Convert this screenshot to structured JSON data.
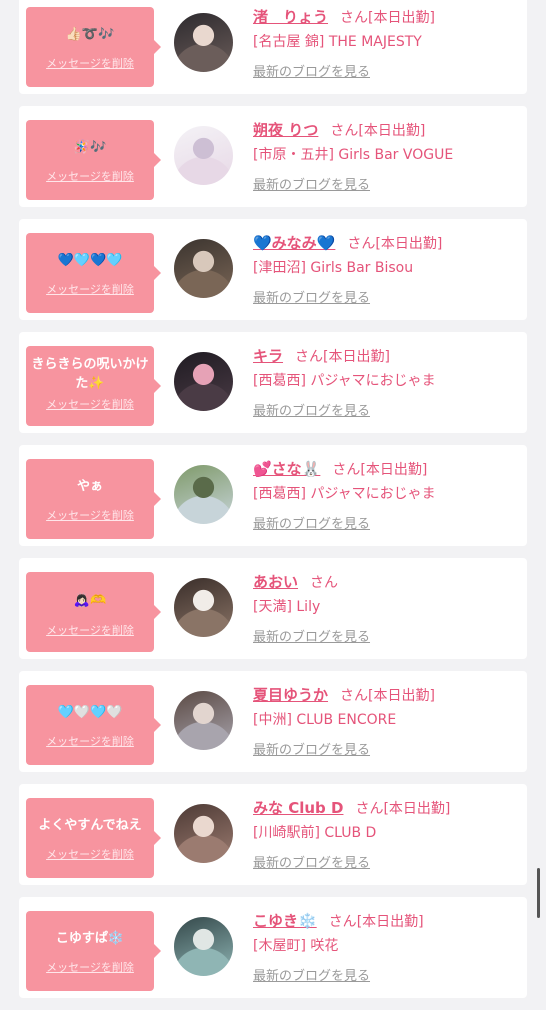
{
  "cards": [
    {
      "message": "👍🏻➰🎶",
      "delete_label": "メッセージを削除",
      "name": "渚　りょう",
      "san": "さん",
      "today": "[本日出勤]",
      "shop": "[名古屋 錦] THE MAJESTY",
      "blog": "最新のブログを見る",
      "avatar_colors": [
        "#2d2a2e",
        "#6b5d5a",
        "#e9d8cf"
      ]
    },
    {
      "message": "🪅🎶",
      "delete_label": "メッセージを削除",
      "name": "朔夜 りつ",
      "san": "さん",
      "today": "[本日出勤]",
      "shop": "[市原・五井] Girls Bar VOGUE",
      "blog": "最新のブログを見る",
      "avatar_colors": [
        "#f4f2f6",
        "#e7d8e6",
        "#cdbfd4"
      ]
    },
    {
      "message": "💙🩵💙🩵",
      "delete_label": "メッセージを削除",
      "name": "💙みなみ💙",
      "san": "さん",
      "today": "[本日出勤]",
      "shop": "[津田沼] Girls Bar Bisou",
      "blog": "最新のブログを見る",
      "avatar_colors": [
        "#3b342f",
        "#7a6656",
        "#d8c8bb"
      ]
    },
    {
      "message": "きらきらの呪いかけた✨",
      "delete_label": "メッセージを削除",
      "name": "キラ",
      "san": "さん",
      "today": "[本日出勤]",
      "shop": "[西葛西] パジャマにおじゃま",
      "blog": "最新のブログを見る",
      "avatar_colors": [
        "#1f1b22",
        "#4a3b45",
        "#e6a2b6"
      ]
    },
    {
      "message": "やぁ",
      "delete_label": "メッセージを削除",
      "name": "💕さな🐰",
      "san": "さん",
      "today": "[本日出勤]",
      "shop": "[西葛西] パジャマにおじゃま",
      "blog": "最新のブログを見る",
      "avatar_colors": [
        "#7f9a6a",
        "#c7d4d9",
        "#5a6b4a"
      ]
    },
    {
      "message": "🙇🏻‍♀️🫶",
      "delete_label": "メッセージを削除",
      "name": "あおい",
      "san": "さん",
      "today": "",
      "shop": "[天満] Lily",
      "blog": "最新のブログを見る",
      "avatar_colors": [
        "#3a2e2a",
        "#8a7466",
        "#f1ece8"
      ]
    },
    {
      "message": "🩵🤍🩵🤍",
      "delete_label": "メッセージを削除",
      "name": "夏目ゆうか",
      "san": "さん",
      "today": "[本日出勤]",
      "shop": "[中洲] CLUB ENCORE",
      "blog": "最新のブログを見る",
      "avatar_colors": [
        "#5b4a44",
        "#a8a4ad",
        "#e2d5cf"
      ]
    },
    {
      "message": "よくやすんでねえ",
      "delete_label": "メッセージを削除",
      "name": "みな Club D",
      "san": "さん",
      "today": "[本日出勤]",
      "shop": "[川崎駅前] CLUB D",
      "blog": "最新のブログを見る",
      "avatar_colors": [
        "#4d3a35",
        "#9b7b70",
        "#ead8cf"
      ]
    },
    {
      "message": "こゆすぱ❄️",
      "delete_label": "メッセージを削除",
      "name": "こゆき❄️",
      "san": "さん",
      "today": "[本日出勤]",
      "shop": "[木屋町] 咲花",
      "blog": "最新のブログを見る",
      "avatar_colors": [
        "#34484a",
        "#8fb5b4",
        "#e0e6e4"
      ]
    }
  ],
  "colors": {
    "bubble": "#f7949f",
    "accent": "#e5547a",
    "muted": "#9a9a9a",
    "background": "#f2f2f4"
  }
}
